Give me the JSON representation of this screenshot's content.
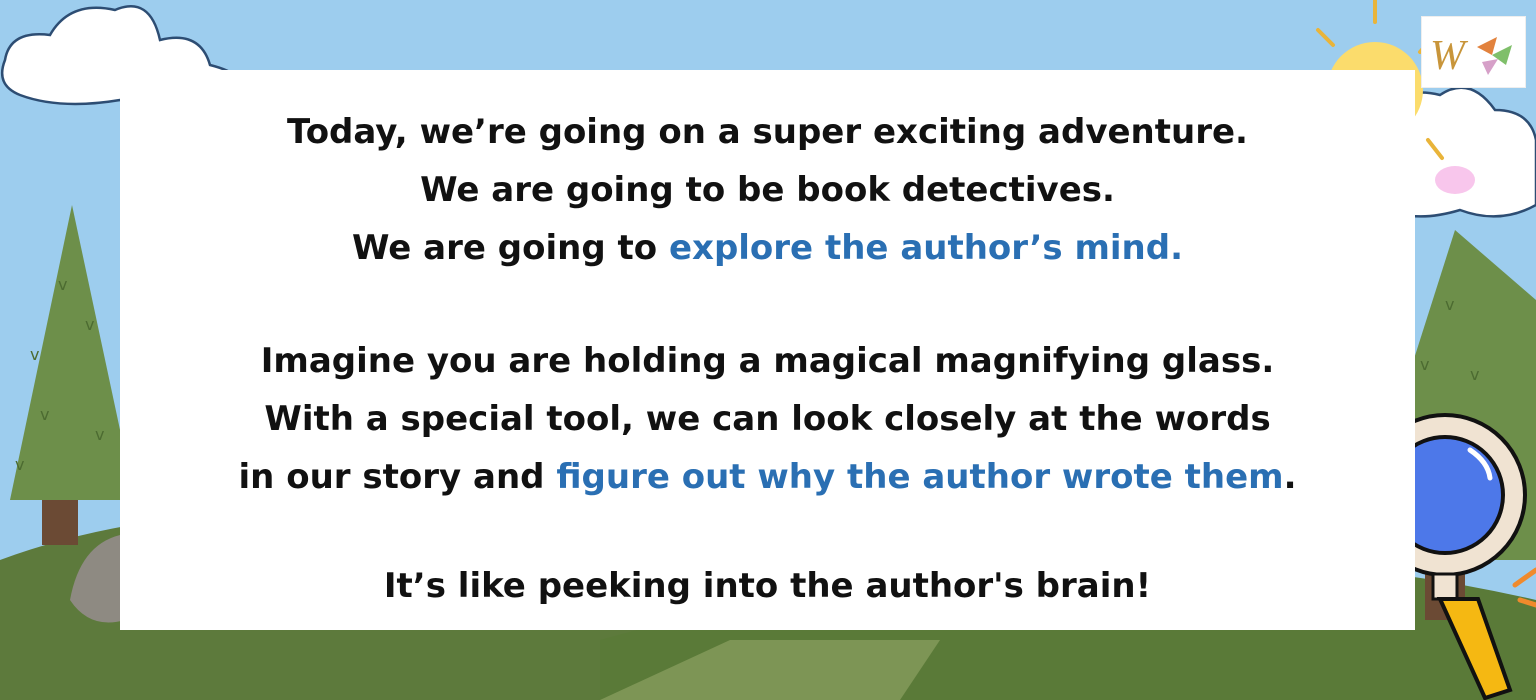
{
  "paragraph1": {
    "line1": "Today, we’re going on a super exciting adventure.",
    "line2": "We are going to be book detectives.",
    "line3_prefix": "We are going to ",
    "line3_highlight": "explore the author’s mind."
  },
  "paragraph2": {
    "line1": "Imagine you are holding a magical magnifying glass.",
    "line2": "With a special tool, we can look closely at the words",
    "line3_prefix": "in our story and ",
    "line3_highlight": "figure out why the author wrote them",
    "line3_suffix": "."
  },
  "paragraph3": {
    "line1": "It’s like peeking into the author's brain!"
  },
  "colors": {
    "sky": "#9dcdee",
    "highlight": "#2a6fb3",
    "panel": "#ffffff",
    "grass": "#5d7a3c"
  },
  "icons": [
    "cloud-icon",
    "sun-icon",
    "tree-icon",
    "rock-icon",
    "magnifying-glass-icon",
    "logo-icon"
  ]
}
